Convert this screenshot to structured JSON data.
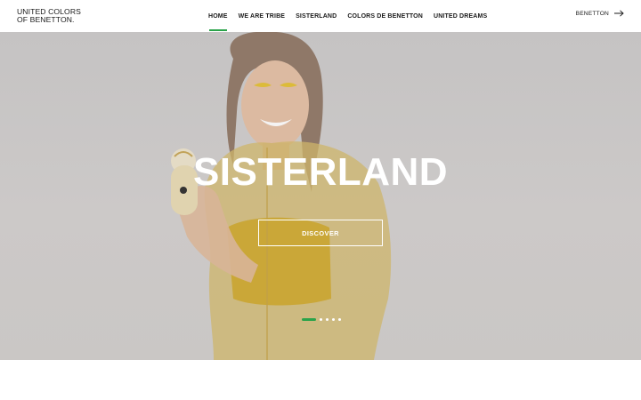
{
  "header": {
    "logo_line1": "UNITED COLORS",
    "logo_line2": "OF BENETTON.",
    "nav": [
      {
        "label": "HOME",
        "active": true
      },
      {
        "label": "WE ARE TRIBE",
        "active": false
      },
      {
        "label": "SISTERLAND",
        "active": false
      },
      {
        "label": "COLORS DE BENETTON",
        "active": false
      },
      {
        "label": "UNITED DREAMS",
        "active": false
      }
    ],
    "brand_link": "BENETTON",
    "brand_link_icon": "arrow-right-icon"
  },
  "hero": {
    "title": "SISTERLAND",
    "button_label": "DISCOVER",
    "slides_total": 5,
    "active_slide": 1
  },
  "colors": {
    "accent": "#2aa34a",
    "text": "#1a1a1a",
    "hero_bg": "#d1d0cf",
    "white": "#ffffff"
  }
}
